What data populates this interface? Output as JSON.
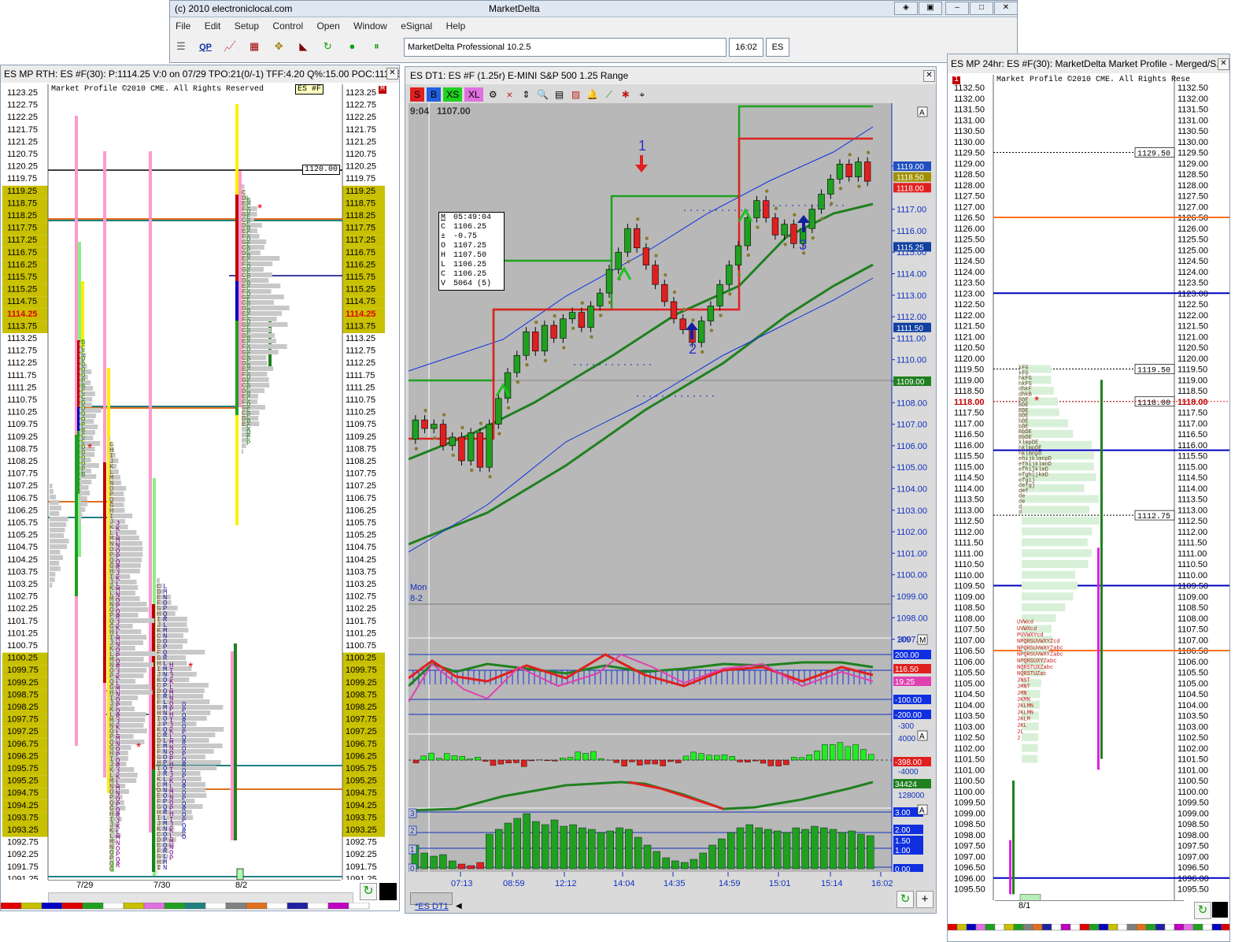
{
  "main_window": {
    "title_left": "(c) 2010 electroniclocal.com",
    "title_center": "MarketDelta",
    "menu": [
      "File",
      "Edit",
      "Setup",
      "Control",
      "Open",
      "Window",
      "eSignal",
      "Help"
    ],
    "toolbar_icons": [
      "list-icon",
      "qp-icon",
      "chart-icon",
      "bars-icon",
      "profile-icon",
      "delta-icon",
      "refresh-icon",
      "play-icon",
      "pause-icon"
    ],
    "qp_label": "QP",
    "status_text": "MarketDelta Professional 10.2.5",
    "time": "16:02",
    "symbol": "ES"
  },
  "left_panel": {
    "title": "ES MP RTH: ES #F(30): P:1114.25 V:0 on 07/29 TPO:21(0/-1) TFF:4.20 Q%:15.00 POC:1110.50",
    "header": "Market Profile ©2010 CME. All Rights Reserved",
    "symbol_tag": "ES #F",
    "corner_label": "M",
    "price_start": 1123.25,
    "price_step": 0.5,
    "price_count": 65,
    "current_price": "1114.25",
    "level_tag": "1120.00",
    "dates": [
      "7/29",
      "7/30",
      "8/2"
    ]
  },
  "center_chart": {
    "title": "ES DT1: ES #F (1.25r) E-MINI S&P 500 1.25 Range",
    "toolbar_buttons": [
      "S",
      "B",
      "XS",
      "XL"
    ],
    "time_label": "9:04",
    "price_label": "1107.00",
    "axis_labels": [
      "1119.00",
      "1117.00",
      "1116.00",
      "1115.00",
      "1114.00",
      "1113.00",
      "1112.00",
      "1111.00",
      "1110.00",
      "1109.00",
      "1108.00",
      "1107.00",
      "1106.00",
      "1105.00",
      "1104.00",
      "1103.00",
      "1102.00",
      "1101.00",
      "1100.00",
      "1099.00",
      "1098.00",
      "1097.00"
    ],
    "axis_y_start": 1119,
    "axis_y_step": -1,
    "price_tags": [
      {
        "value": "1119.00",
        "color": "#2050c0"
      },
      {
        "value": "1118.50",
        "color": "#a09000"
      },
      {
        "value": "1118.00",
        "color": "#e02020"
      },
      {
        "value": "1115.25",
        "color": "#1040a0"
      },
      {
        "value": "1111.50",
        "color": "#1040a0"
      },
      {
        "value": "1109.00",
        "color": "#208020"
      }
    ],
    "data_box": [
      {
        "k": "M",
        "v": "05:49:04"
      },
      {
        "k": "C",
        "v": "1106.25"
      },
      {
        "k": "±",
        "v": "-0.75"
      },
      {
        "k": "O",
        "v": "1107.25"
      },
      {
        "k": "H",
        "v": "1107.50"
      },
      {
        "k": "L",
        "v": "1106.25"
      },
      {
        "k": "C",
        "v": "1106.25"
      },
      {
        "k": "V",
        "v": "5064 (5)"
      }
    ],
    "annotations": [
      "1",
      "2",
      "3"
    ],
    "day_label_1": "Mon",
    "day_label_2": "8-2",
    "osc1_labels": [
      "300",
      "200.00",
      "116.50",
      "19.25",
      "-100.00",
      "-200.00",
      "-300",
      "-400"
    ],
    "osc2_labels": [
      "4000",
      "-398.00",
      "-4000",
      "34424",
      "128000"
    ],
    "osc3_labels": [
      "3.00",
      "2.00",
      "1.50",
      "1.00",
      "0.00"
    ],
    "osc3_left": [
      "3",
      "2",
      "1",
      "0"
    ],
    "time_axis": [
      "07:13",
      "08:59",
      "12:12",
      "14:04",
      "14:35",
      "14:59",
      "15:01",
      "15:14",
      "16:02"
    ],
    "tab_label": "*ES DT1",
    "corner_labels": [
      "A",
      "M",
      "M",
      "A",
      "A",
      "A"
    ]
  },
  "right_panel": {
    "title": "ES MP 24hr: ES #F(30): MarketDelta Market Profile - Merged/S...",
    "header": "Market Profile ©2010 CME. All Rights Rese",
    "price_start": 1132.5,
    "price_step": 0.5,
    "price_count": 75,
    "current_price": "1118.00",
    "level_tags": [
      "1129.50",
      "1119.50",
      "1118.00",
      "1112.75"
    ],
    "date": "8/1",
    "corner_label": "1"
  },
  "colors": {
    "up_candle": "#20a020",
    "down_candle": "#e02020",
    "profile_yellow": "#c8c000",
    "chart_bg": "#b8b8b8",
    "axis_blue": "#1030c0"
  }
}
